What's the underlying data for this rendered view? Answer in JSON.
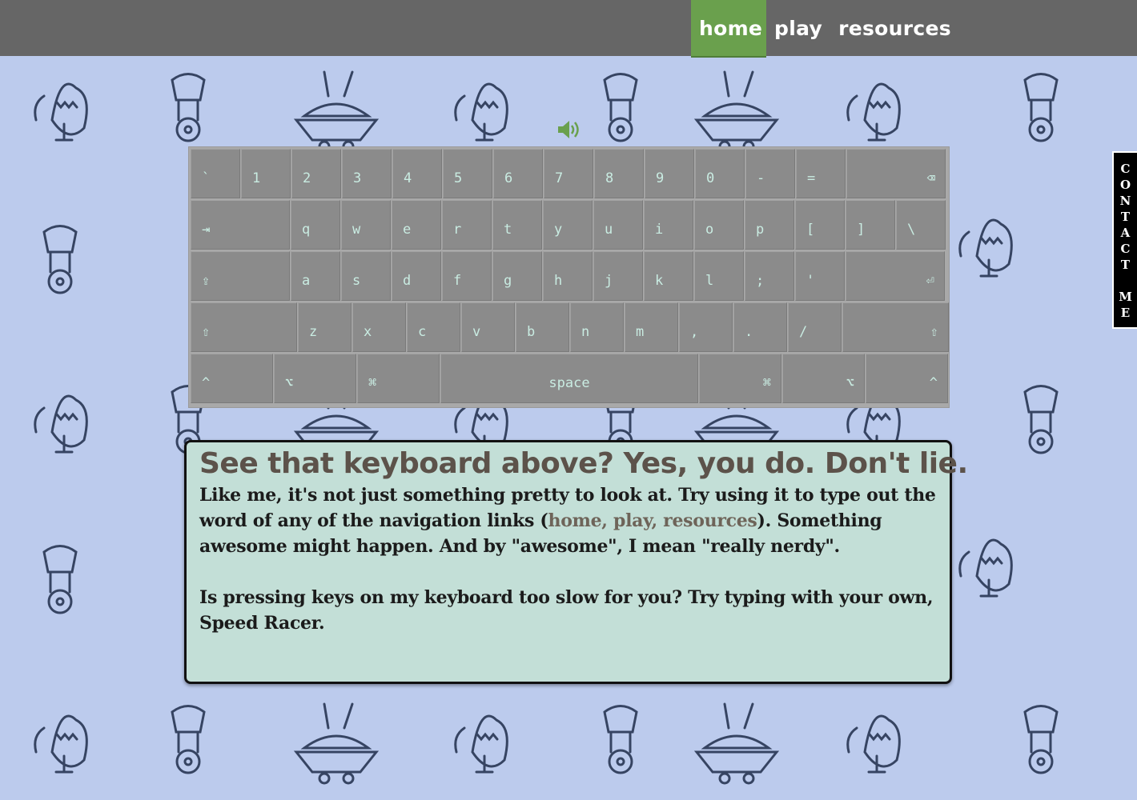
{
  "nav": {
    "items": [
      {
        "label": "home",
        "active": true
      },
      {
        "label": "play",
        "active": false
      },
      {
        "label": "resources",
        "active": false
      }
    ]
  },
  "speaker": {
    "icon": "speaker-icon"
  },
  "keyboard": {
    "rows": [
      [
        {
          "l": "`"
        },
        {
          "l": "1"
        },
        {
          "l": "2"
        },
        {
          "l": "3"
        },
        {
          "l": "4"
        },
        {
          "l": "5"
        },
        {
          "l": "6"
        },
        {
          "l": "7"
        },
        {
          "l": "8"
        },
        {
          "l": "9"
        },
        {
          "l": "0"
        },
        {
          "l": "-"
        },
        {
          "l": "="
        },
        {
          "l": "⌫",
          "right": true,
          "w": 2
        }
      ],
      [
        {
          "l": "⇥",
          "w": 2
        },
        {
          "l": "q"
        },
        {
          "l": "w"
        },
        {
          "l": "e"
        },
        {
          "l": "r"
        },
        {
          "l": "t"
        },
        {
          "l": "y"
        },
        {
          "l": "u"
        },
        {
          "l": "i"
        },
        {
          "l": "o"
        },
        {
          "l": "p"
        },
        {
          "l": "["
        },
        {
          "l": "]"
        },
        {
          "l": "\\"
        }
      ],
      [
        {
          "l": "⇪",
          "w": 2
        },
        {
          "l": "a"
        },
        {
          "l": "s"
        },
        {
          "l": "d"
        },
        {
          "l": "f"
        },
        {
          "l": "g"
        },
        {
          "l": "h"
        },
        {
          "l": "j"
        },
        {
          "l": "k"
        },
        {
          "l": "l"
        },
        {
          "l": ";"
        },
        {
          "l": "'"
        },
        {
          "l": "⏎",
          "right": true,
          "w": 2
        }
      ],
      [
        {
          "l": "⇧",
          "w": 2
        },
        {
          "l": "z"
        },
        {
          "l": "x"
        },
        {
          "l": "c"
        },
        {
          "l": "v"
        },
        {
          "l": "b"
        },
        {
          "l": "n"
        },
        {
          "l": "m"
        },
        {
          "l": ","
        },
        {
          "l": "."
        },
        {
          "l": "/"
        },
        {
          "l": "⇧",
          "right": true,
          "w": 2
        }
      ],
      [
        {
          "l": "^"
        },
        {
          "l": "⌥"
        },
        {
          "l": "⌘"
        },
        {
          "l": "space",
          "center": true,
          "w": 3
        },
        {
          "l": "⌘",
          "right": true
        },
        {
          "l": "⌥",
          "right": true
        },
        {
          "l": "^",
          "right": true
        }
      ]
    ]
  },
  "panel": {
    "heading": "See that keyboard above? Yes, you do. Don't lie.",
    "p1_before": "Like me, it's not just something pretty to look at. Try using it to type out the word of any of the navigation links (",
    "p1_links": "home, play, resources",
    "p1_after": "). Something awesome might happen. And by \"awesome\", I mean \"really nerdy\".",
    "p2": "Is pressing keys on my keyboard too slow for you? Try typing with your own, Speed Racer."
  },
  "contact": {
    "letters": [
      "C",
      "O",
      "N",
      "T",
      "A",
      "C",
      "T",
      "",
      "M",
      "E"
    ]
  },
  "colors": {
    "background": "#bccbed",
    "topbar": "#666666",
    "active_nav": "#6aa04d",
    "panel": "#c3dfd7",
    "key": "#8b8b8b",
    "key_text": "#c9ece2"
  }
}
